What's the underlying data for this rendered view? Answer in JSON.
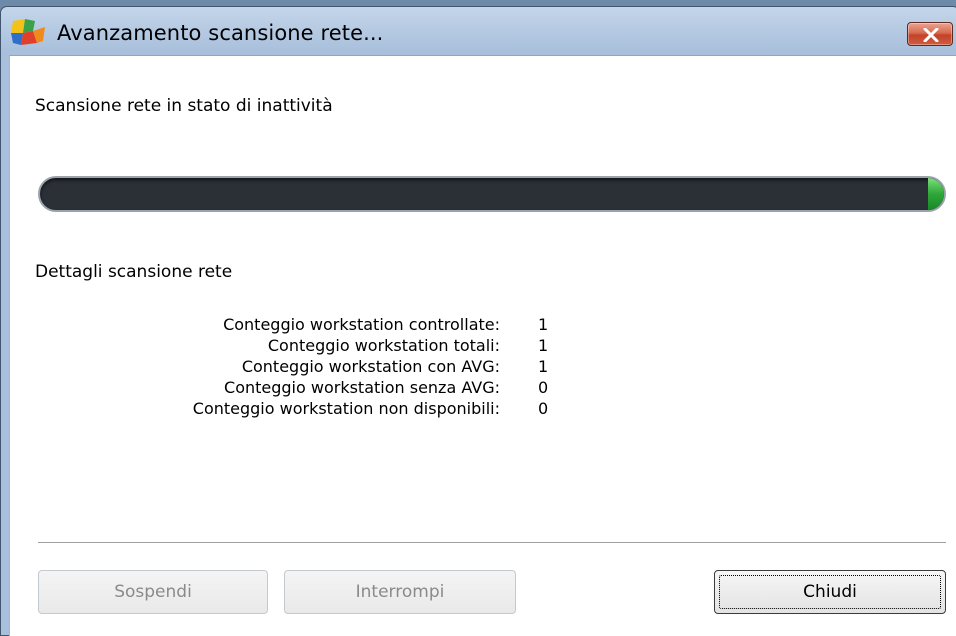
{
  "window": {
    "title": "Avanzamento scansione rete...",
    "icon": "avg-logo-icon"
  },
  "titlebar": {
    "close_icon": "close-icon"
  },
  "status": {
    "text": "Scansione rete in stato di inattività",
    "progress_percent": 100
  },
  "details": {
    "heading": "Dettagli scansione rete",
    "rows": [
      {
        "label": "Conteggio workstation controllate:",
        "value": "1"
      },
      {
        "label": "Conteggio workstation totali:",
        "value": "1"
      },
      {
        "label": "Conteggio workstation con AVG:",
        "value": "1"
      },
      {
        "label": "Conteggio workstation senza AVG:",
        "value": "0"
      },
      {
        "label": "Conteggio workstation non disponibili:",
        "value": "0"
      }
    ]
  },
  "buttons": {
    "suspend_label": "Sospendi",
    "stop_label": "Interrompi",
    "close_label": "Chiudi"
  },
  "colors": {
    "progress_track": "#2b2f36",
    "progress_fill": "#2fa63a",
    "close_button": "#c2432a"
  }
}
